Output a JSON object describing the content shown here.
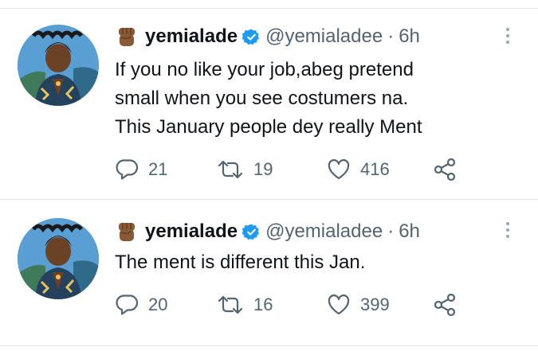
{
  "tweets": [
    {
      "author_name": "yemialade",
      "handle": "@yemialadee",
      "separator": "·",
      "time": "6h",
      "text": "If you no like your job,abeg pretend\nsmall when you see costumers na.\nThis January people dey really Ment",
      "replies": "21",
      "retweets": "19",
      "likes": "416"
    },
    {
      "author_name": "yemialade",
      "handle": "@yemialadee",
      "separator": "·",
      "time": "6h",
      "text": "The ment is different this Jan.",
      "replies": "20",
      "retweets": "16",
      "likes": "399"
    }
  ],
  "icons": {
    "emoji": "raised-fist-emoji-icon",
    "verified": "verified-badge-icon",
    "more": "more-options-icon",
    "reply": "reply-icon",
    "retweet": "retweet-icon",
    "like": "heart-icon",
    "share": "share-icon"
  },
  "colors": {
    "verified": "#1d9bf0",
    "secondary_text": "#536471",
    "divider": "#e3e7ea",
    "fist": "#8a5a37"
  }
}
